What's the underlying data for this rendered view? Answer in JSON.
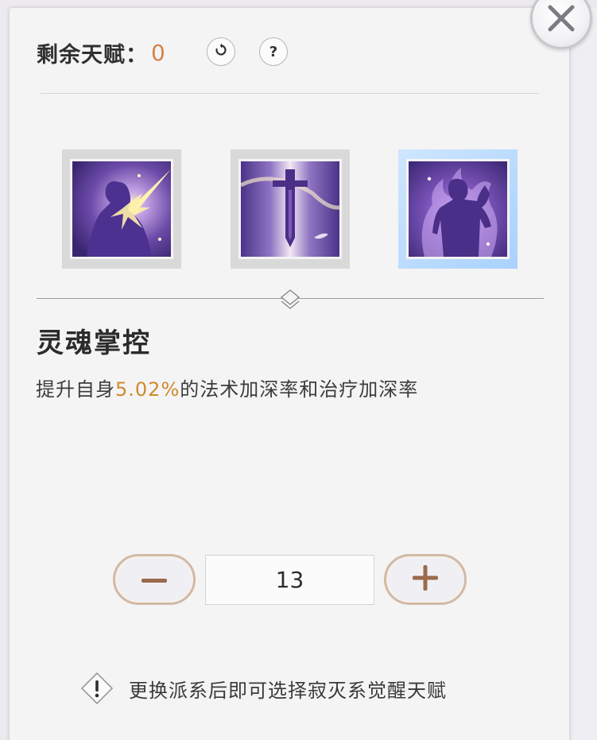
{
  "header": {
    "remaining_label": "剩余天赋：",
    "remaining_value": "0",
    "reset_icon": "reset-icon",
    "help_label": "?"
  },
  "close": {
    "icon": "close-icon"
  },
  "skills": [
    {
      "name": "skill-1",
      "icon": "shatter-strike-icon",
      "selected": false
    },
    {
      "name": "skill-2",
      "icon": "sword-icon",
      "selected": false
    },
    {
      "name": "skill-3",
      "icon": "flame-body-icon",
      "selected": true
    }
  ],
  "detail": {
    "title": "灵魂掌控",
    "desc_prefix": "提升自身",
    "desc_value": "5.02%",
    "desc_suffix": "的法术加深率和治疗加深率"
  },
  "stepper": {
    "minus_label": "−",
    "value": "13",
    "plus_label": "+"
  },
  "notice": {
    "icon": "warning-icon",
    "text": "更换派系后即可选择寂灭系觉醒天赋"
  },
  "colors": {
    "accent": "#d2824c",
    "highlight": "#d08a2c",
    "selected_frame": "#a9d2ff"
  }
}
